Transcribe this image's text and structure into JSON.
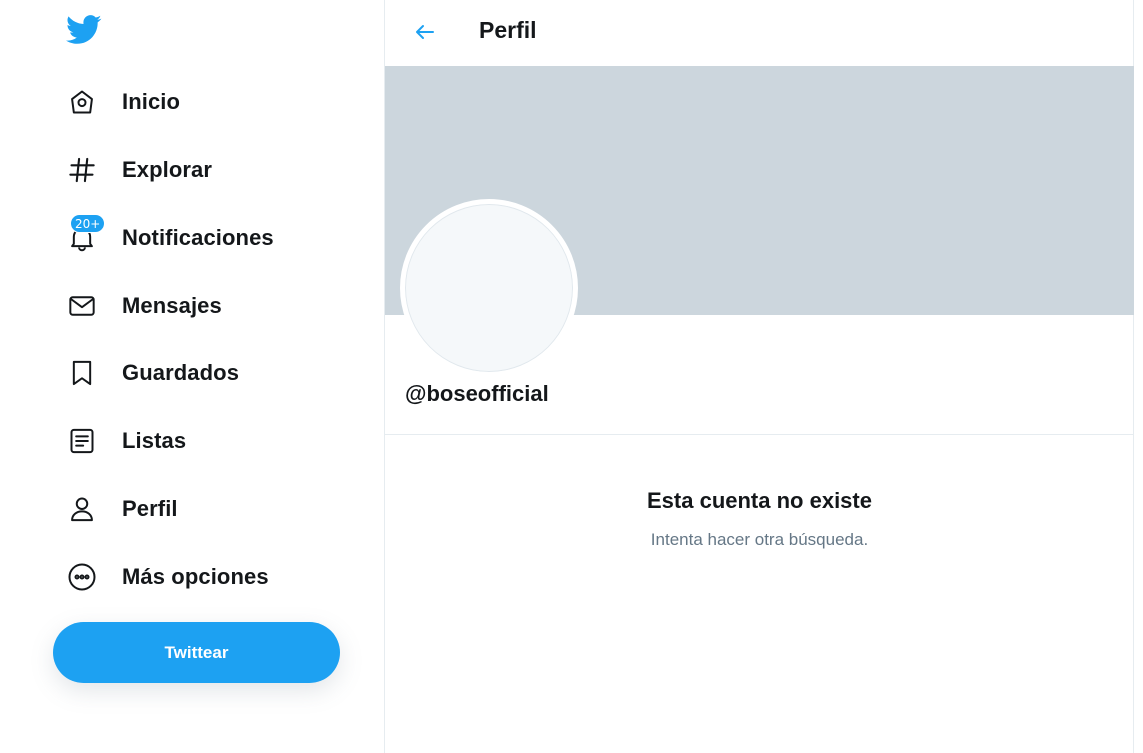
{
  "sidebar": {
    "logo_icon": "twitter-bird-icon",
    "items": [
      {
        "label": "Inicio",
        "icon": "home-icon"
      },
      {
        "label": "Explorar",
        "icon": "hashtag-icon"
      },
      {
        "label": "Notificaciones",
        "icon": "bell-icon",
        "badge": "20+"
      },
      {
        "label": "Mensajes",
        "icon": "envelope-icon"
      },
      {
        "label": "Guardados",
        "icon": "bookmark-icon"
      },
      {
        "label": "Listas",
        "icon": "list-icon"
      },
      {
        "label": "Perfil",
        "icon": "person-icon"
      },
      {
        "label": "Más opciones",
        "icon": "more-circle-icon"
      }
    ],
    "tweet_button": "Twittear"
  },
  "header": {
    "back_icon": "arrow-left-icon",
    "title": "Perfil"
  },
  "profile": {
    "handle": "@boseofficial",
    "empty_title": "Esta cuenta no existe",
    "empty_subtitle": "Intenta hacer otra búsqueda."
  },
  "colors": {
    "accent": "#1da1f2",
    "banner": "#ccd6dd",
    "text": "#14171a",
    "muted": "#657786"
  }
}
